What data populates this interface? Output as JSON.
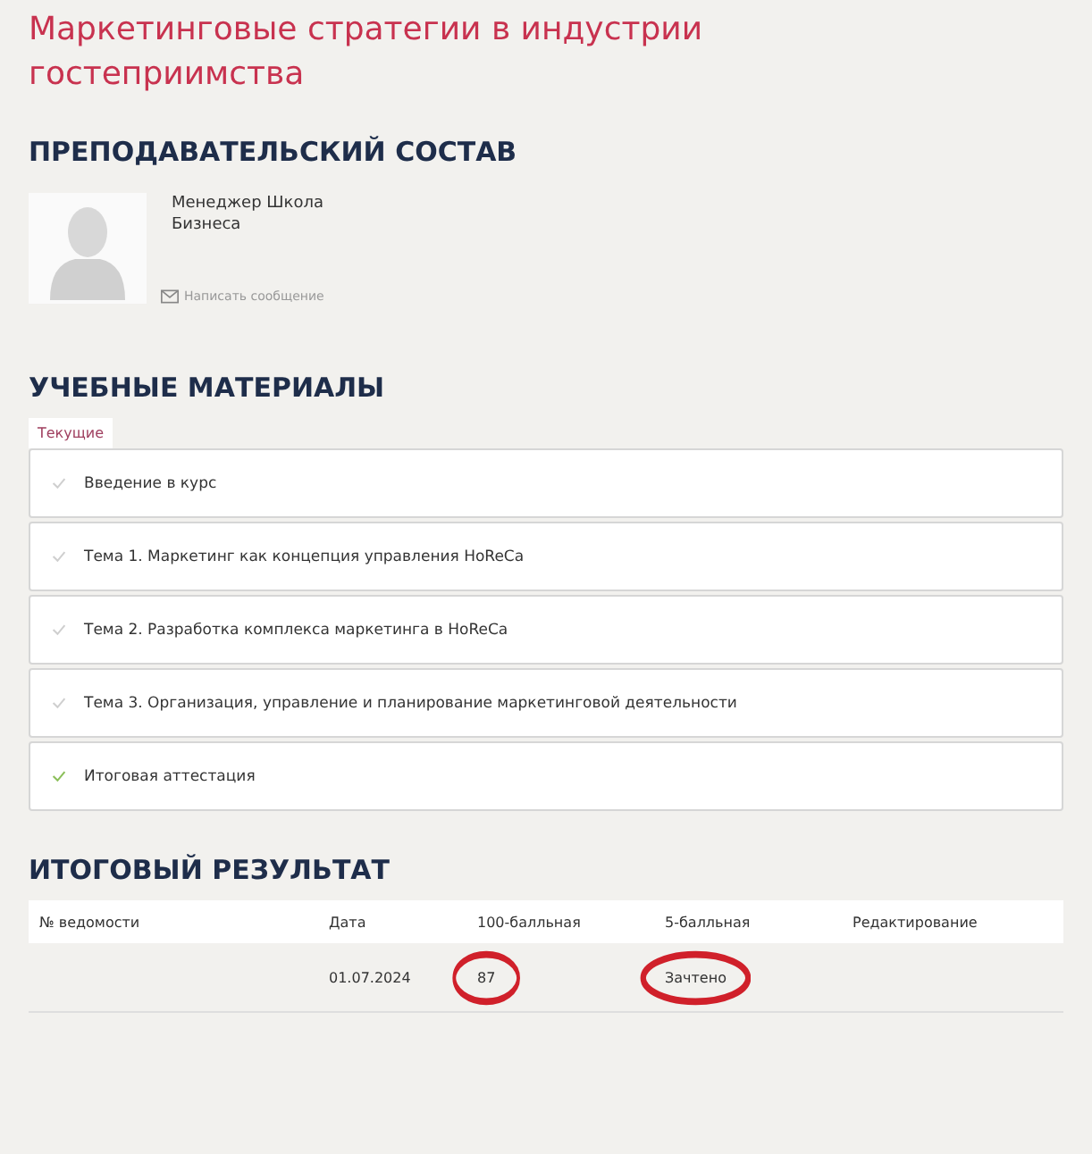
{
  "title": "Маркетинговые стратегии в индустрии гостеприимства",
  "faculty": {
    "heading": "ПРЕПОДАВАТЕЛЬСКИЙ СОСТАВ",
    "name": "Менеджер Школа Бизнеса",
    "message_link": "Написать сообщение"
  },
  "materials": {
    "heading": "УЧЕБНЫЕ МАТЕРИАЛЫ",
    "tabs": [
      {
        "label": "Текущие",
        "selected": true
      }
    ],
    "items": [
      {
        "label": "Введение в курс",
        "done": false
      },
      {
        "label": "Тема 1. Маркетинг как концепция управления HoReCa",
        "done": false
      },
      {
        "label": "Тема 2. Разработка комплекса маркетинга в HoReCa",
        "done": false
      },
      {
        "label": "Тема 3. Организация, управление и планирование маркетинговой деятельности",
        "done": false
      },
      {
        "label": "Итоговая аттестация",
        "done": true
      }
    ]
  },
  "result": {
    "heading": "ИТОГОВЫЙ РЕЗУЛЬТАТ",
    "columns": [
      "№ ведомости",
      "Дата",
      "100-балльная",
      "5-балльная",
      "Редактирование"
    ],
    "rows": [
      {
        "date": {
          "text": "01.07.2024",
          "circled": false
        },
        "score_100": {
          "text": "87",
          "circled": true
        },
        "score_5": {
          "text": "Зачтено",
          "circled": true
        }
      }
    ]
  }
}
